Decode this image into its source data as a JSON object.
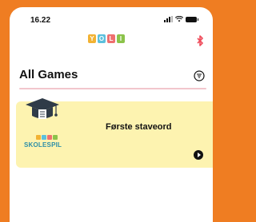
{
  "status_bar": {
    "time": "16.22"
  },
  "app": {
    "logo_letters": [
      "Y",
      "O",
      "L",
      "I"
    ],
    "logo_colors": [
      "#f2b233",
      "#5cc0dd",
      "#ef6f6f",
      "#8bc34a"
    ]
  },
  "header": {
    "title": "All Games"
  },
  "games": [
    {
      "title": "Første staveord",
      "image_caption": "SKOLESPIL"
    }
  ],
  "colors": {
    "background": "#ef7d22",
    "card": "#fdf3b0",
    "accent": "#ef4b5a",
    "divider": "#f2c6cc"
  },
  "icons": {
    "connection": "bluetooth-icon",
    "filter": "filter-icon",
    "play": "play-icon"
  }
}
